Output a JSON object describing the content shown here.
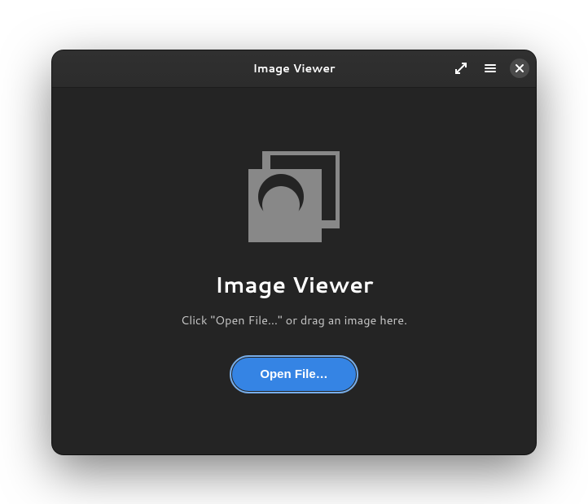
{
  "window": {
    "title": "Image Viewer"
  },
  "content": {
    "heading": "Image Viewer",
    "subtext": "Click \"Open File…\" or drag an image here.",
    "open_button_label": "Open File…"
  },
  "colors": {
    "accent": "#3584e4",
    "background": "#242424",
    "titlebar": "#303030"
  }
}
